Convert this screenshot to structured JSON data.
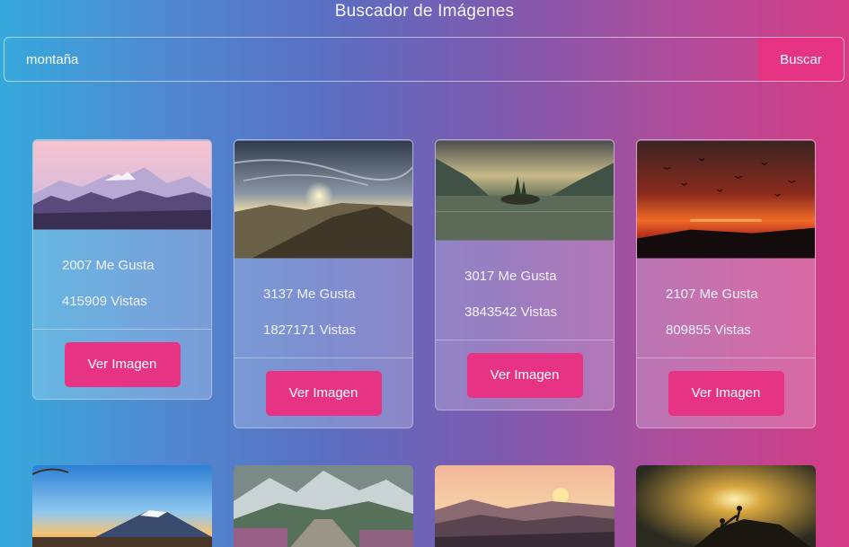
{
  "header": {
    "title": "Buscador de Imágenes"
  },
  "search": {
    "value": "montaña",
    "button_label": "Buscar"
  },
  "colors": {
    "accent": "#e63384"
  },
  "cards": [
    {
      "likes": "2007 Me Gusta",
      "views": "415909 Vistas",
      "button": "Ver Imagen",
      "thumb": "mountain-range-icon"
    },
    {
      "likes": "3137 Me Gusta",
      "views": "1827171 Vistas",
      "button": "Ver Imagen",
      "thumb": "sunset-clouds-icon"
    },
    {
      "likes": "3017 Me Gusta",
      "views": "3843542 Vistas",
      "button": "Ver Imagen",
      "thumb": "lake-island-icon"
    },
    {
      "likes": "2107 Me Gusta",
      "views": "809855 Vistas",
      "button": "Ver Imagen",
      "thumb": "red-sunset-birds-icon"
    }
  ],
  "bottom_row": [
    "mount-fuji-icon",
    "snowy-peaks-path-icon",
    "misty-sunrise-icon",
    "climbers-silhouette-icon"
  ]
}
